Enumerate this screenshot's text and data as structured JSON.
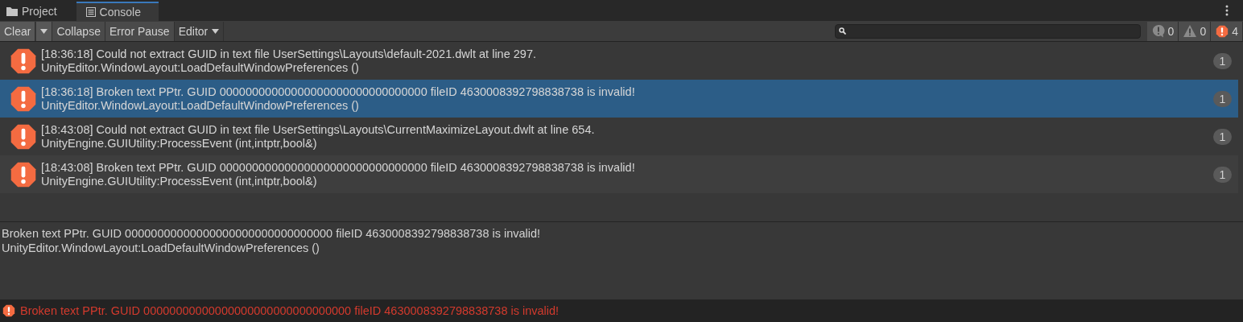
{
  "tabs": [
    {
      "label": "Project",
      "kind": "folder",
      "selected": false
    },
    {
      "label": "Console",
      "kind": "console",
      "selected": true
    }
  ],
  "toolbar": {
    "buttons": [
      {
        "label": "Clear",
        "kind": "split"
      },
      {
        "label": "Collapse",
        "kind": "toggle"
      },
      {
        "label": "Error Pause",
        "kind": "toggle"
      },
      {
        "label": "Editor",
        "kind": "dropdown"
      }
    ],
    "counters": [
      {
        "kind": "log",
        "count": "0"
      },
      {
        "kind": "warning",
        "count": "0"
      },
      {
        "kind": "error",
        "count": "4"
      }
    ]
  },
  "entries": [
    {
      "message": "[18:36:18] Could not extract GUID in text file UserSettings\\Layouts\\default-2021.dwlt at line 297.",
      "trace": "UnityEditor.WindowLayout:LoadDefaultWindowPreferences ()",
      "count": "1",
      "selected": false
    },
    {
      "message": "[18:36:18] Broken text PPtr. GUID 00000000000000000000000000000000 fileID 4630008392798838738 is invalid!",
      "trace": "UnityEditor.WindowLayout:LoadDefaultWindowPreferences ()",
      "count": "1",
      "selected": true
    },
    {
      "message": "[18:43:08] Could not extract GUID in text file UserSettings\\Layouts\\CurrentMaximizeLayout.dwlt at line 654.",
      "trace": "UnityEngine.GUIUtility:ProcessEvent (int,intptr,bool&)",
      "count": "1",
      "selected": false
    },
    {
      "message": "[18:43:08] Broken text PPtr. GUID 00000000000000000000000000000000 fileID 4630008392798838738 is invalid!",
      "trace": "UnityEngine.GUIUtility:ProcessEvent (int,intptr,bool&)",
      "count": "1",
      "selected": false
    }
  ],
  "detail": [
    "Broken text PPtr. GUID 00000000000000000000000000000000 fileID 4630008392798838738 is invalid!",
    "UnityEditor.WindowLayout:LoadDefaultWindowPreferences ()"
  ],
  "status_bar": {
    "message": "Broken text PPtr. GUID 00000000000000000000000000000000 fileID 4630008392798838738 is invalid!"
  }
}
